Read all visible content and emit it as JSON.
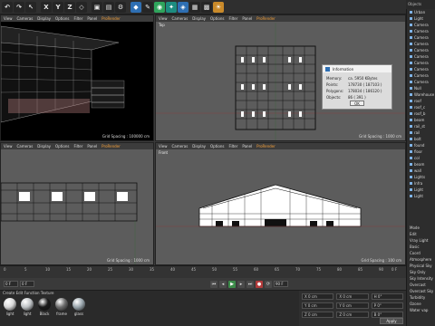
{
  "toolbar": {
    "buttons": [
      {
        "name": "undo-button",
        "glyph": "↶",
        "style": "dark"
      },
      {
        "name": "redo-button",
        "glyph": "↷",
        "style": "dark"
      },
      {
        "name": "select-button",
        "glyph": "↖",
        "style": "dark"
      },
      {
        "name": "axis-x-button",
        "glyph": "X",
        "style": "dark"
      },
      {
        "name": "axis-y-button",
        "glyph": "Y",
        "style": "dark"
      },
      {
        "name": "axis-z-button",
        "glyph": "Z",
        "style": "dark"
      },
      {
        "name": "coord-system-button",
        "glyph": "◇",
        "style": "dark"
      },
      {
        "name": "render-view-button",
        "glyph": "▣",
        "style": "dark"
      },
      {
        "name": "render-region-button",
        "glyph": "▤",
        "style": "dark"
      },
      {
        "name": "render-settings-button",
        "glyph": "⚙",
        "style": "dark"
      },
      {
        "name": "cube-button",
        "glyph": "◆",
        "style": "blue"
      },
      {
        "name": "pen-button",
        "glyph": "✎",
        "style": "dark"
      },
      {
        "name": "subdivision-button",
        "glyph": "◉",
        "style": "green"
      },
      {
        "name": "array-button",
        "glyph": "✦",
        "style": "teal"
      },
      {
        "name": "deformer-button",
        "glyph": "◈",
        "style": "blue"
      },
      {
        "name": "scene-button",
        "glyph": "▦",
        "style": "dark"
      },
      {
        "name": "camera-button",
        "glyph": "▩",
        "style": "dark"
      },
      {
        "name": "light-button",
        "glyph": "☀",
        "style": "orange"
      }
    ]
  },
  "right_top": {
    "label": "Objects"
  },
  "viewports": {
    "menu": [
      "View",
      "Cameras",
      "Display",
      "Options",
      "Filter",
      "Panel",
      "ProRender"
    ],
    "active_menu": "ProRender",
    "persp": {
      "label": "",
      "grid": "Grid Spacing : 100000 cm"
    },
    "top": {
      "label": "Top",
      "grid": "Grid Spacing : 1000 cm"
    },
    "right": {
      "label": "",
      "grid": "Grid Spacing : 1000 cm"
    },
    "front": {
      "label": "Front",
      "grid": "Grid Spacing : 100 cm"
    }
  },
  "info_dialog": {
    "title": "Information",
    "rows": [
      {
        "key": "Memory:",
        "value": "ca. 5950 KBytes"
      },
      {
        "key": "Points:",
        "value": "178730 ( 187103 )"
      },
      {
        "key": "Polygons:",
        "value": "178034 ( 186120 )"
      },
      {
        "key": "Objects:",
        "value": "86 ( 391 )"
      }
    ],
    "ok_label": "OK"
  },
  "object_manager": {
    "items": [
      "Urban",
      "Light",
      "Camera",
      "Camera",
      "Camera",
      "Camera",
      "Camera",
      "Camera",
      "Camera",
      "Camera",
      "Camera",
      "Camera",
      "Null",
      "Warehouse",
      "roof",
      "roof_c",
      "roof_b",
      "beam",
      "rail_st",
      "rail",
      "bolt",
      "found",
      "floor",
      "col",
      "beam",
      "wall",
      "Lights",
      "Infra",
      "Light",
      "Light"
    ]
  },
  "attribute_manager": {
    "items": [
      "Mode",
      "Edit",
      "Vray Light",
      "Basic",
      "Coord",
      "Atmosphere",
      "Physical Sky",
      "Sky Only",
      "Sky Intensity",
      "Overcast",
      "Overcast Sky",
      "Turbidity",
      "Ozone",
      "Water vap"
    ]
  },
  "timeline": {
    "ticks": [
      "0",
      "5",
      "10",
      "15",
      "20",
      "25",
      "30",
      "35",
      "40",
      "45",
      "50",
      "55",
      "60",
      "65",
      "70",
      "75",
      "80",
      "85",
      "90"
    ],
    "end_label": "0 F",
    "current_frame": "0 F",
    "start_field": "0 F",
    "end_field": "90 F"
  },
  "materials": {
    "menu": "Create  Edit  Function  Texture",
    "items": [
      {
        "label": "light",
        "color": "#d8d8d8"
      },
      {
        "label": "light",
        "color": "#bfc3c6"
      },
      {
        "label": "Black",
        "color": "#1a1a1a"
      },
      {
        "label": "frame",
        "color": "#6d6d6d"
      },
      {
        "label": "glass",
        "color": "#9aa6ad"
      }
    ]
  },
  "coordinates": {
    "rows": [
      [
        "X 0 cm",
        "X 0 cm",
        "H 0°"
      ],
      [
        "Y 0 cm",
        "Y 0 cm",
        "P 0°"
      ],
      [
        "Z 0 cm",
        "Z 0 cm",
        "B 0°"
      ]
    ],
    "apply_label": "Apply"
  }
}
